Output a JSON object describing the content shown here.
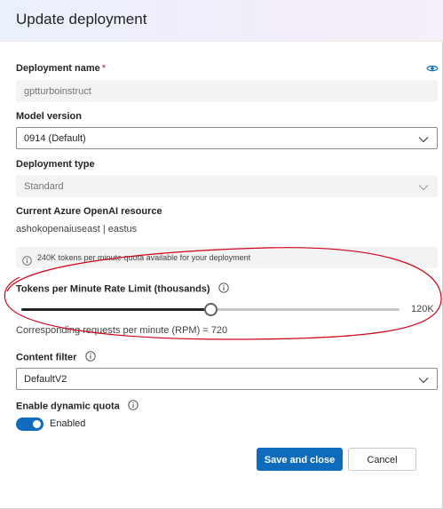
{
  "dialog": {
    "title": "Update deployment"
  },
  "deployment_name": {
    "label": "Deployment name",
    "required_mark": "*",
    "value": "gptturboinstruct"
  },
  "model_version": {
    "label": "Model version",
    "value": "0914 (Default)"
  },
  "deployment_type": {
    "label": "Deployment type",
    "value": "Standard"
  },
  "resource": {
    "label": "Current Azure OpenAI resource",
    "value": "ashokopenaiuseast | eastus"
  },
  "quota_info": {
    "text": "240K tokens per minute quota available for your deployment"
  },
  "rate_limit": {
    "label": "Tokens per Minute Rate Limit (thousands)",
    "value": 120,
    "min": 0,
    "max": 240,
    "value_label": "120K",
    "rpm_text": "Corresponding requests per minute (RPM) = 720"
  },
  "content_filter": {
    "label": "Content filter",
    "value": "DefaultV2"
  },
  "dynamic_quota": {
    "label": "Enable dynamic quota",
    "state_label": "Enabled",
    "on": true
  },
  "buttons": {
    "save_label": "Save and close",
    "cancel_label": "Cancel"
  },
  "colors": {
    "primary": "#0f6cbd",
    "required": "#c50f1f",
    "annotation": "#d0021b"
  },
  "icons": {
    "eye": "eye-icon",
    "info": "info-icon",
    "chevron": "chevron-down-icon"
  }
}
